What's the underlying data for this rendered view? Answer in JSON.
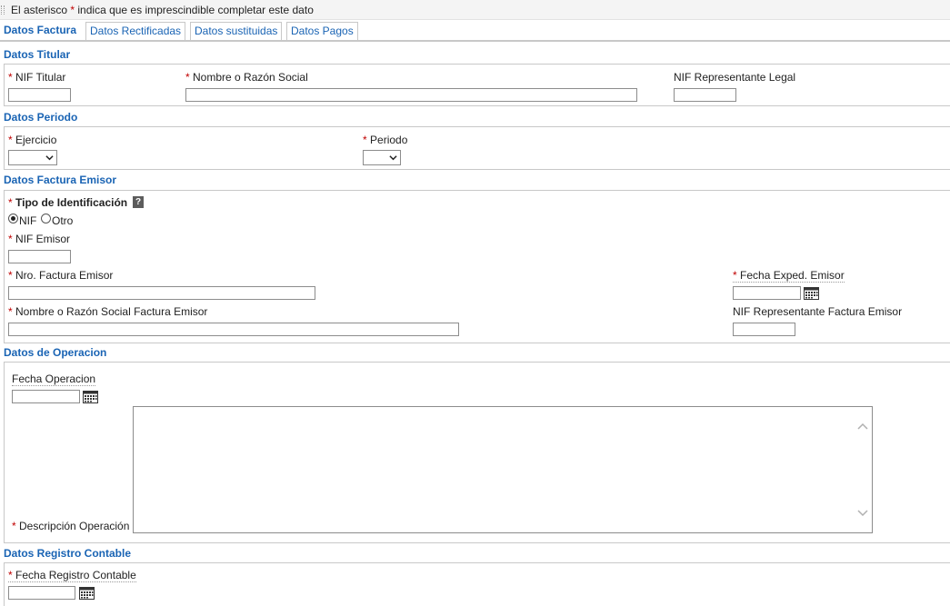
{
  "header": {
    "note_prefix": "El asterisco",
    "asterisk": "*",
    "note_suffix": "indica que es imprescindible completar este dato"
  },
  "tabs": [
    {
      "label": "Datos Factura"
    },
    {
      "label": "Datos Rectificadas"
    },
    {
      "label": "Datos sustituidas"
    },
    {
      "label": "Datos Pagos"
    }
  ],
  "sections": {
    "titular": {
      "title": "Datos Titular",
      "nif_label": "NIF Titular",
      "nombre_label": "Nombre o Razón Social",
      "rep_label": "NIF Representante Legal"
    },
    "periodo": {
      "title": "Datos Periodo",
      "ejercicio_label": "Ejercicio",
      "periodo_label": "Periodo"
    },
    "emisor": {
      "title": "Datos Factura Emisor",
      "tipo_label": "Tipo de Identificación",
      "help": "?",
      "radio_nif": "NIF",
      "radio_otro": "Otro",
      "nif_label": "NIF Emisor",
      "nro_label": "Nro. Factura Emisor",
      "fecha_label": "Fecha Exped. Emisor",
      "nombre_label": "Nombre o Razón Social Factura Emisor",
      "rep_label": "NIF Representante Factura Emisor"
    },
    "operacion": {
      "title": "Datos de Operacion",
      "fecha_label": "Fecha Operacion",
      "desc_label": "Descripción Operación"
    },
    "registro": {
      "title": "Datos Registro Contable",
      "fecha_label": "Fecha Registro Contable"
    }
  },
  "asterisk": "*",
  "colors": {
    "accent": "#1a64b4",
    "required": "#c00000",
    "border": "#c8c8c8"
  }
}
